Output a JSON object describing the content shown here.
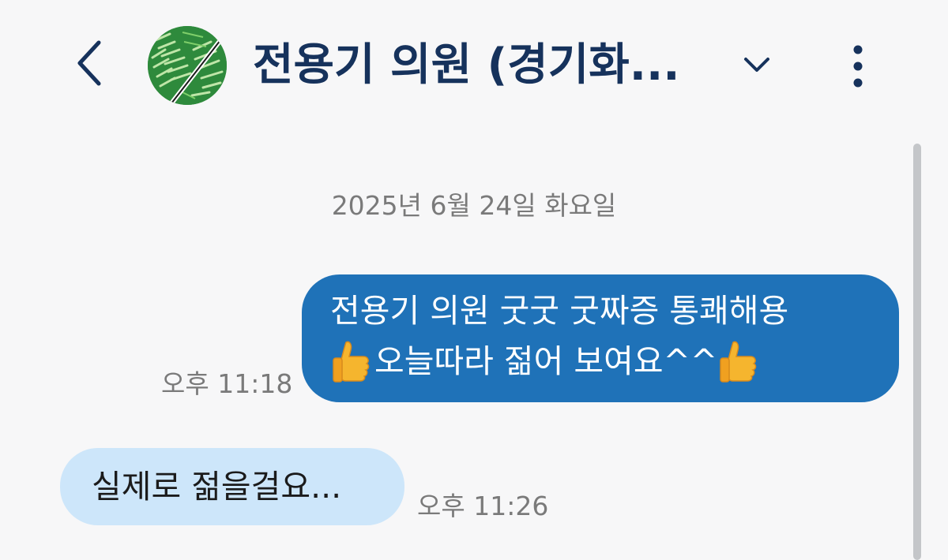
{
  "header": {
    "title": "전용기 의원 (경기화...",
    "back_icon": "back-arrow-icon",
    "dropdown_icon": "chevron-down-icon",
    "more_icon": "more-vertical-icon",
    "title_color": "#16325c"
  },
  "conversation": {
    "date_separator": "2025년 6월 24일 화요일",
    "messages": [
      {
        "direction": "outgoing",
        "line1": "전용기 의원 굿굿 굿짜증 통쾌해용",
        "line2": "오늘따라 젊어 보여요^^",
        "emoji": "thumbs-up-icon",
        "time": "오후 11:18",
        "bubble_color": "#1f72b8"
      },
      {
        "direction": "incoming",
        "text": "실제로 젊을걸요...",
        "time": "오후 11:26",
        "bubble_color": "#cde6fa"
      }
    ]
  }
}
